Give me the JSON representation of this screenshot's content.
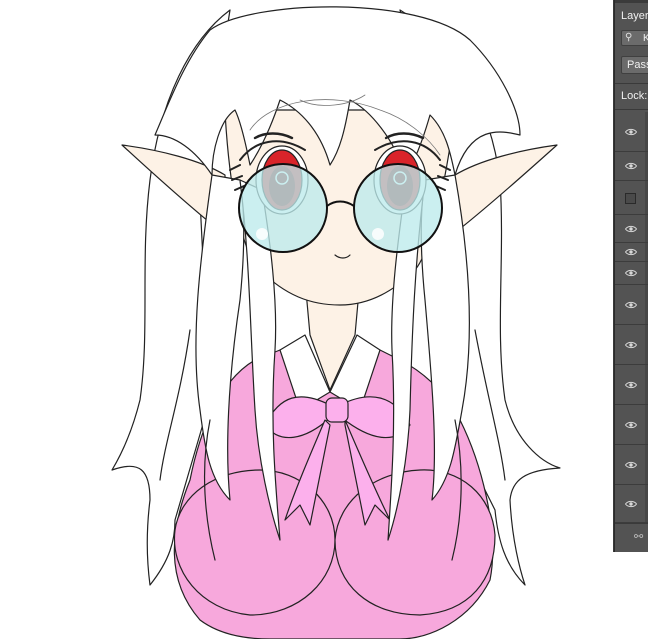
{
  "layers_panel": {
    "title": "Layers",
    "search": {
      "icon": "search-icon",
      "kind_label": "Ki"
    },
    "blend_mode": "Pass",
    "lock_label": "Lock:",
    "rows": [
      {
        "visible": true
      },
      {
        "visible": true
      },
      {
        "visible": false
      },
      {
        "visible": true
      },
      {
        "visible": true
      },
      {
        "visible": true
      },
      {
        "visible": true
      },
      {
        "visible": true
      },
      {
        "visible": true
      },
      {
        "visible": true
      },
      {
        "visible": true
      },
      {
        "visible": true
      }
    ],
    "footer_icon": "link-icon"
  },
  "colors": {
    "panel_bg": "#535353",
    "skin": "#fdf2e6",
    "vest_pink": "#f7a8dc",
    "bow_pink": "#fcb0ec",
    "lens_cyan": "#bcebec",
    "iris_red": "#d9242a"
  }
}
